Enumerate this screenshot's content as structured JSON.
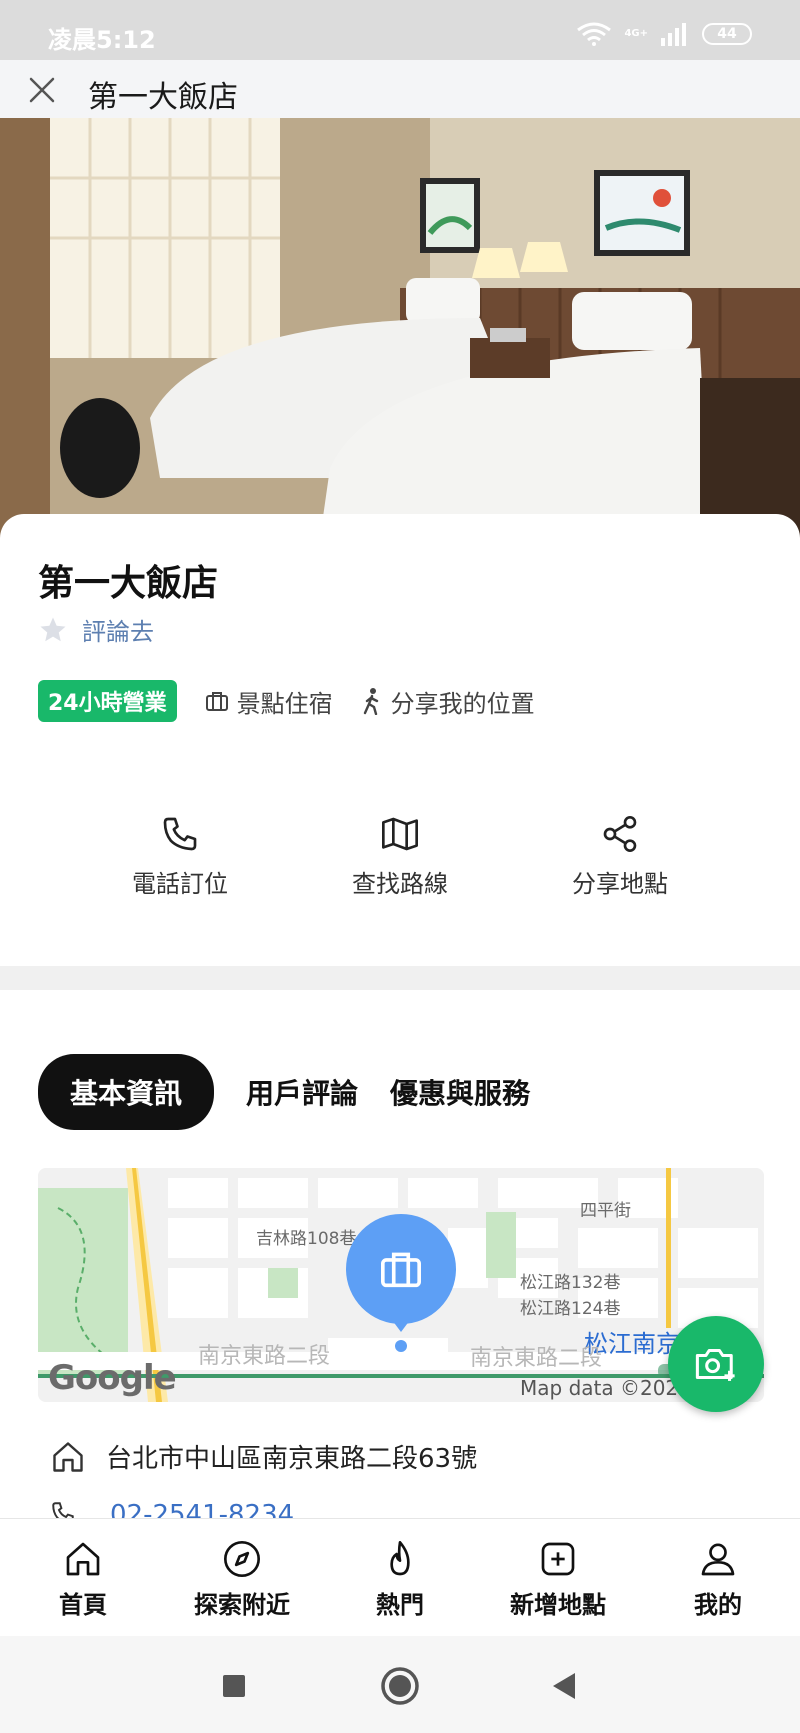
{
  "status_bar": {
    "time": "凌晨5:12",
    "network": "4G+",
    "battery": "44"
  },
  "header": {
    "title": "第一大飯店"
  },
  "place": {
    "name": "第一大飯店",
    "review_link": "評論去",
    "open_badge": "24小時營業",
    "category": "景點住宿",
    "share_location": "分享我的位置"
  },
  "actions": {
    "call": "電話訂位",
    "route": "查找路線",
    "share": "分享地點"
  },
  "tabs": {
    "basic": "基本資訊",
    "reviews": "用戶評論",
    "offers": "優惠與服務"
  },
  "map": {
    "label_jilin": "吉林路108巷",
    "label_siping": "四平街",
    "label_songjiang_132": "松江路132巷",
    "label_songjiang_124": "松江路124巷",
    "station": "松江南京",
    "road_left": "南京東路二段",
    "road_right": "南京東路二段",
    "google": "Google",
    "copyright": "Map data ©2020"
  },
  "details": {
    "address": "台北市中山區南京東路二段63號",
    "phone": "02-2541-8234"
  },
  "bottom_nav": {
    "home": "首頁",
    "explore": "探索附近",
    "popular": "熱門",
    "add_place": "新增地點",
    "me": "我的"
  },
  "colors": {
    "brand_green": "#19b86a",
    "map_pin": "#5d9ff5",
    "link_blue": "#5d7fb0"
  }
}
